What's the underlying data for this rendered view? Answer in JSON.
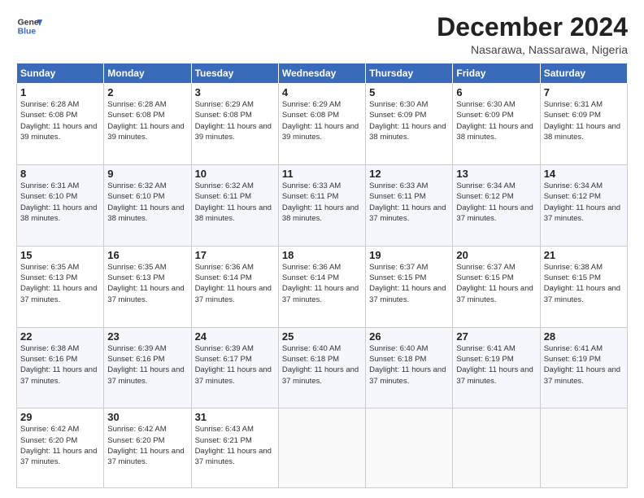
{
  "header": {
    "logo_line1": "General",
    "logo_line2": "Blue",
    "month": "December 2024",
    "location": "Nasarawa, Nassarawa, Nigeria"
  },
  "weekdays": [
    "Sunday",
    "Monday",
    "Tuesday",
    "Wednesday",
    "Thursday",
    "Friday",
    "Saturday"
  ],
  "weeks": [
    [
      {
        "day": "1",
        "sunrise": "6:28 AM",
        "sunset": "6:08 PM",
        "daylight": "11 hours and 39 minutes."
      },
      {
        "day": "2",
        "sunrise": "6:28 AM",
        "sunset": "6:08 PM",
        "daylight": "11 hours and 39 minutes."
      },
      {
        "day": "3",
        "sunrise": "6:29 AM",
        "sunset": "6:08 PM",
        "daylight": "11 hours and 39 minutes."
      },
      {
        "day": "4",
        "sunrise": "6:29 AM",
        "sunset": "6:08 PM",
        "daylight": "11 hours and 39 minutes."
      },
      {
        "day": "5",
        "sunrise": "6:30 AM",
        "sunset": "6:09 PM",
        "daylight": "11 hours and 38 minutes."
      },
      {
        "day": "6",
        "sunrise": "6:30 AM",
        "sunset": "6:09 PM",
        "daylight": "11 hours and 38 minutes."
      },
      {
        "day": "7",
        "sunrise": "6:31 AM",
        "sunset": "6:09 PM",
        "daylight": "11 hours and 38 minutes."
      }
    ],
    [
      {
        "day": "8",
        "sunrise": "6:31 AM",
        "sunset": "6:10 PM",
        "daylight": "11 hours and 38 minutes."
      },
      {
        "day": "9",
        "sunrise": "6:32 AM",
        "sunset": "6:10 PM",
        "daylight": "11 hours and 38 minutes."
      },
      {
        "day": "10",
        "sunrise": "6:32 AM",
        "sunset": "6:11 PM",
        "daylight": "11 hours and 38 minutes."
      },
      {
        "day": "11",
        "sunrise": "6:33 AM",
        "sunset": "6:11 PM",
        "daylight": "11 hours and 38 minutes."
      },
      {
        "day": "12",
        "sunrise": "6:33 AM",
        "sunset": "6:11 PM",
        "daylight": "11 hours and 37 minutes."
      },
      {
        "day": "13",
        "sunrise": "6:34 AM",
        "sunset": "6:12 PM",
        "daylight": "11 hours and 37 minutes."
      },
      {
        "day": "14",
        "sunrise": "6:34 AM",
        "sunset": "6:12 PM",
        "daylight": "11 hours and 37 minutes."
      }
    ],
    [
      {
        "day": "15",
        "sunrise": "6:35 AM",
        "sunset": "6:13 PM",
        "daylight": "11 hours and 37 minutes."
      },
      {
        "day": "16",
        "sunrise": "6:35 AM",
        "sunset": "6:13 PM",
        "daylight": "11 hours and 37 minutes."
      },
      {
        "day": "17",
        "sunrise": "6:36 AM",
        "sunset": "6:14 PM",
        "daylight": "11 hours and 37 minutes."
      },
      {
        "day": "18",
        "sunrise": "6:36 AM",
        "sunset": "6:14 PM",
        "daylight": "11 hours and 37 minutes."
      },
      {
        "day": "19",
        "sunrise": "6:37 AM",
        "sunset": "6:15 PM",
        "daylight": "11 hours and 37 minutes."
      },
      {
        "day": "20",
        "sunrise": "6:37 AM",
        "sunset": "6:15 PM",
        "daylight": "11 hours and 37 minutes."
      },
      {
        "day": "21",
        "sunrise": "6:38 AM",
        "sunset": "6:15 PM",
        "daylight": "11 hours and 37 minutes."
      }
    ],
    [
      {
        "day": "22",
        "sunrise": "6:38 AM",
        "sunset": "6:16 PM",
        "daylight": "11 hours and 37 minutes."
      },
      {
        "day": "23",
        "sunrise": "6:39 AM",
        "sunset": "6:16 PM",
        "daylight": "11 hours and 37 minutes."
      },
      {
        "day": "24",
        "sunrise": "6:39 AM",
        "sunset": "6:17 PM",
        "daylight": "11 hours and 37 minutes."
      },
      {
        "day": "25",
        "sunrise": "6:40 AM",
        "sunset": "6:18 PM",
        "daylight": "11 hours and 37 minutes."
      },
      {
        "day": "26",
        "sunrise": "6:40 AM",
        "sunset": "6:18 PM",
        "daylight": "11 hours and 37 minutes."
      },
      {
        "day": "27",
        "sunrise": "6:41 AM",
        "sunset": "6:19 PM",
        "daylight": "11 hours and 37 minutes."
      },
      {
        "day": "28",
        "sunrise": "6:41 AM",
        "sunset": "6:19 PM",
        "daylight": "11 hours and 37 minutes."
      }
    ],
    [
      {
        "day": "29",
        "sunrise": "6:42 AM",
        "sunset": "6:20 PM",
        "daylight": "11 hours and 37 minutes."
      },
      {
        "day": "30",
        "sunrise": "6:42 AM",
        "sunset": "6:20 PM",
        "daylight": "11 hours and 37 minutes."
      },
      {
        "day": "31",
        "sunrise": "6:43 AM",
        "sunset": "6:21 PM",
        "daylight": "11 hours and 37 minutes."
      },
      null,
      null,
      null,
      null
    ]
  ]
}
